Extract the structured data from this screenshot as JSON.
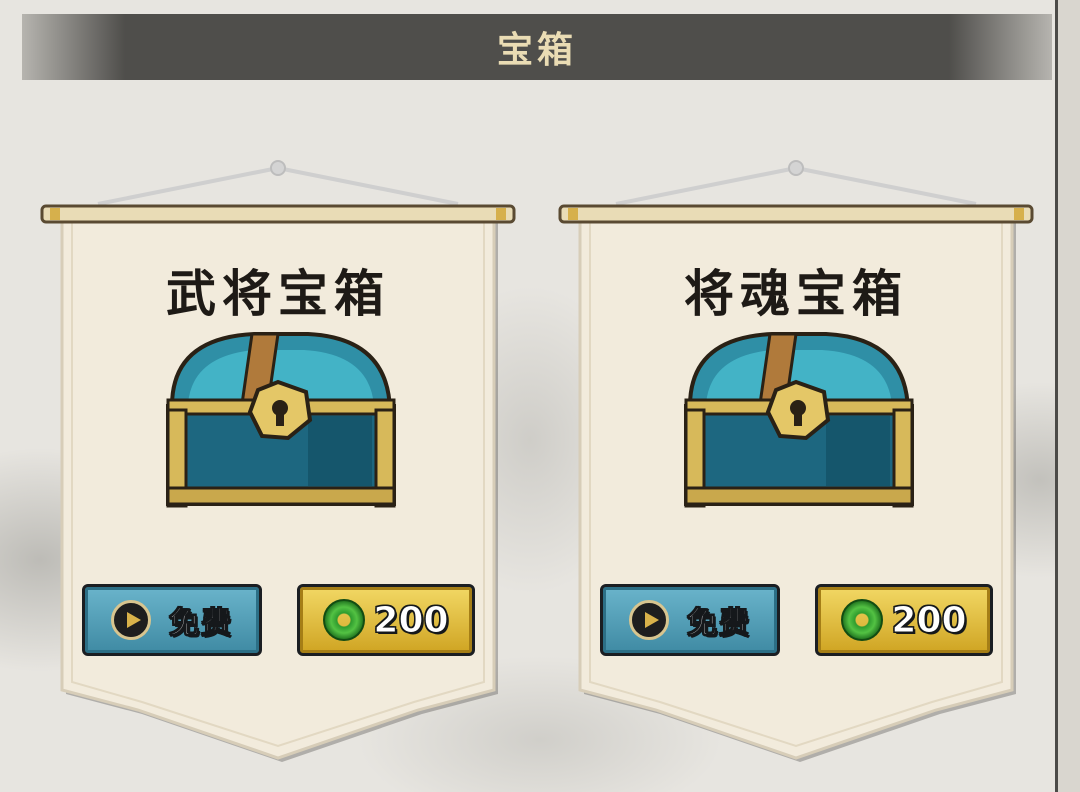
{
  "header": {
    "title": "宝箱"
  },
  "banners": [
    {
      "title": "武将宝箱",
      "free_label": "免费",
      "price": "200",
      "icons": {
        "free": "play-icon",
        "currency": "jade-coin-icon",
        "chest": "treasure-chest"
      }
    },
    {
      "title": "将魂宝箱",
      "free_label": "免费",
      "price": "200",
      "icons": {
        "free": "play-icon",
        "currency": "jade-coin-icon",
        "chest": "treasure-chest"
      }
    }
  ],
  "colors": {
    "header_bg": "#4f4e4b",
    "header_text": "#eadcb4",
    "banner_cloth": "#f2ebdc",
    "free_button": "#4f9cb5",
    "buy_button": "#e3c13f"
  }
}
